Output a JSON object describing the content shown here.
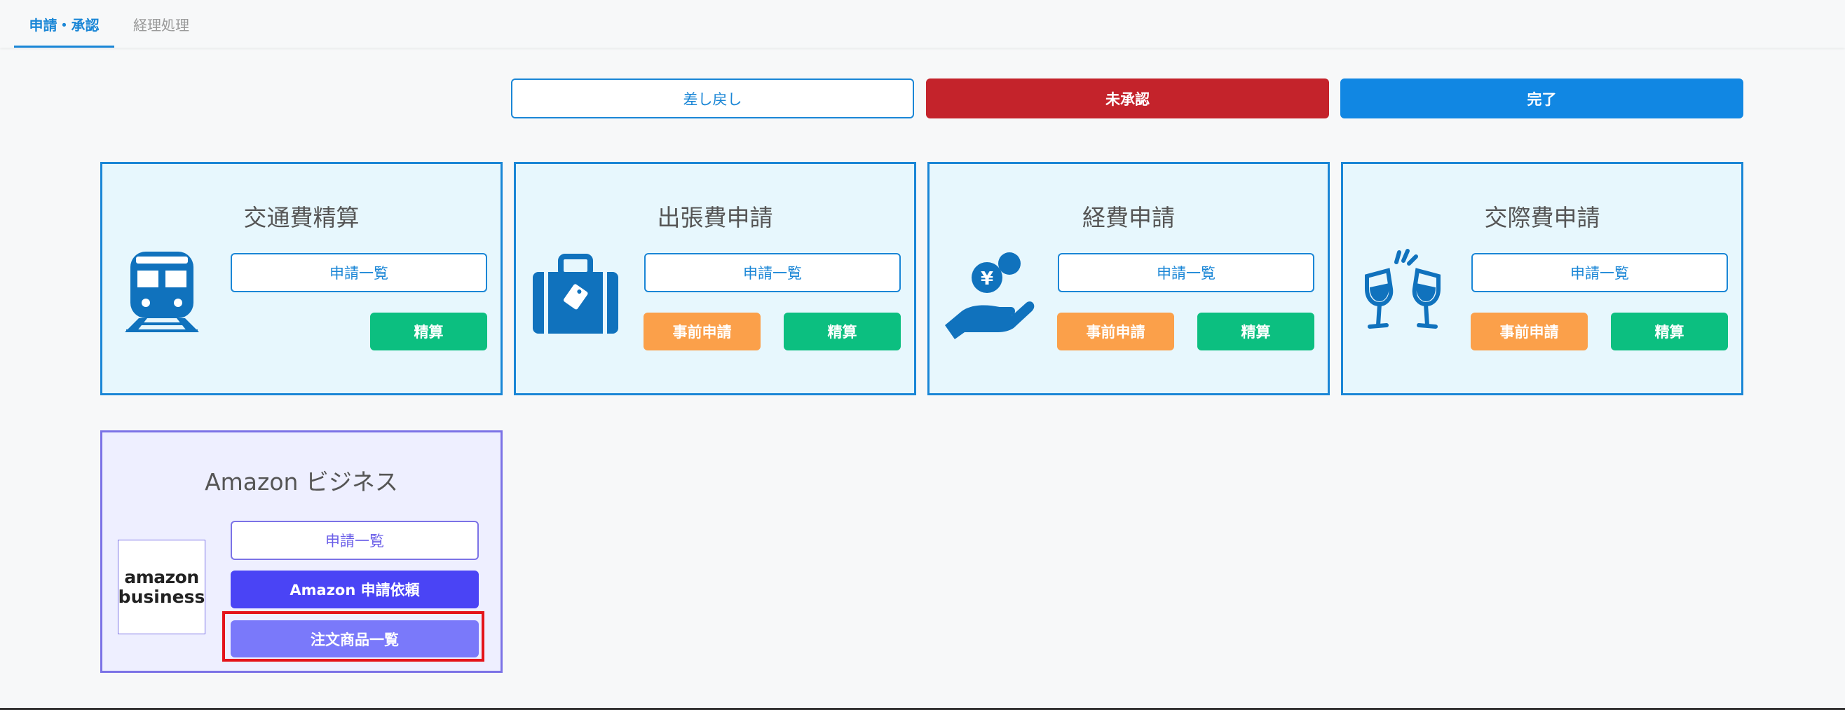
{
  "tabs": [
    {
      "label": "申請・承認",
      "active": true
    },
    {
      "label": "経理処理",
      "active": false
    }
  ],
  "status_buttons": {
    "returned": "差し戻し",
    "unapproved": "未承認",
    "completed": "完了"
  },
  "cards": [
    {
      "title": "交通費精算",
      "icon": "train-icon",
      "list_label": "申請一覧",
      "settle_label": "精算"
    },
    {
      "title": "出張費申請",
      "icon": "briefcase-icon",
      "list_label": "申請一覧",
      "pre_label": "事前申請",
      "settle_label": "精算"
    },
    {
      "title": "経費申請",
      "icon": "hand-yen-icon",
      "list_label": "申請一覧",
      "pre_label": "事前申請",
      "settle_label": "精算"
    },
    {
      "title": "交際費申請",
      "icon": "toast-glasses-icon",
      "list_label": "申請一覧",
      "pre_label": "事前申請",
      "settle_label": "精算"
    }
  ],
  "amazon": {
    "title": "Amazon ビジネス",
    "logo_line1": "amazon",
    "logo_line2": "business",
    "list_label": "申請一覧",
    "request_label": "Amazon 申請依頼",
    "orders_label": "注文商品一覧"
  },
  "colors": {
    "accent": "#1a86d6",
    "red": "#c4232b",
    "blue": "#1187e3",
    "green": "#0cbf80",
    "orange": "#fba04a",
    "amazon_purple": "#4a44f5",
    "highlight": "#e4141a"
  }
}
